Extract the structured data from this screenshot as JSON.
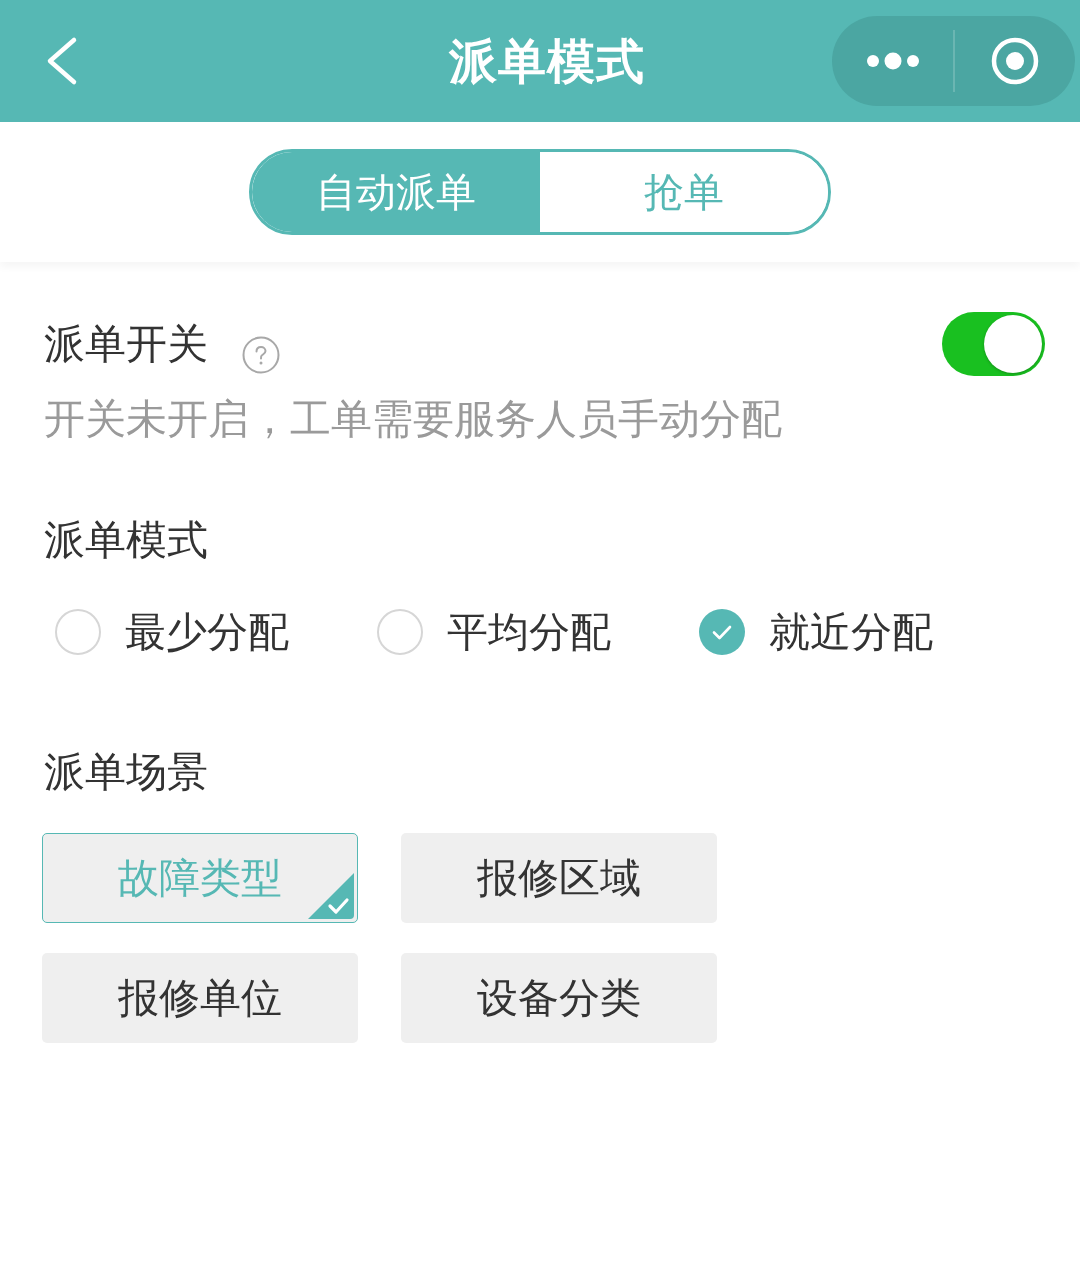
{
  "header": {
    "title": "派单模式"
  },
  "mode_tabs": [
    {
      "label": "自动派单",
      "selected": true
    },
    {
      "label": "抢单",
      "selected": false
    }
  ],
  "dispatch_switch": {
    "label": "派单开关",
    "on": true,
    "description": "开关未开启，工单需要服务人员手动分配"
  },
  "dispatch_mode": {
    "label": "派单模式",
    "options": [
      {
        "label": "最少分配",
        "selected": false
      },
      {
        "label": "平均分配",
        "selected": false
      },
      {
        "label": "就近分配",
        "selected": true
      }
    ]
  },
  "dispatch_scenes": {
    "label": "派单场景",
    "options": [
      {
        "label": "故障类型",
        "selected": true
      },
      {
        "label": "报修区域",
        "selected": false
      },
      {
        "label": "报修单位",
        "selected": false
      },
      {
        "label": "设备分类",
        "selected": false
      }
    ]
  }
}
